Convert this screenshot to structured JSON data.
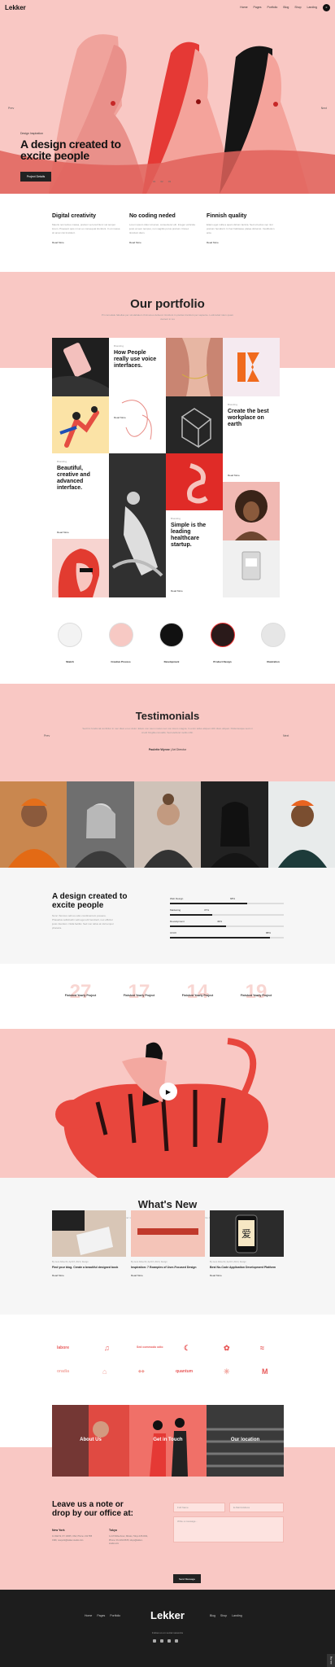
{
  "nav": {
    "logo": "Lekker",
    "links": [
      "Home",
      "Pages",
      "Portfolio",
      "Blog",
      "Shop",
      "Landing"
    ],
    "cart_count": "0"
  },
  "hero": {
    "prev": "Prev",
    "next": "Next",
    "eyebrow": "Design Inspiration",
    "title": "A design created to excite people",
    "button": "Project Details",
    "dots": [
      "01",
      "02",
      "03"
    ]
  },
  "features": [
    {
      "title": "Digital creativity",
      "text": "Mauris non lectus massa, pretium vel erat Nunc vel tempor lorem. Praesent quis mi ac ex consequat tincidunt. In ut massa sit amet nisi tincidunt.",
      "more": "Read More"
    },
    {
      "title": "No coding neded",
      "text": "Lorem ipsum dolor sit amet, consectetur elit. Integer vehicula justo at sem tempus, non sagittis purus pretium. Donec tincidunt diam.",
      "more": "Read More"
    },
    {
      "title": "Finnish quality",
      "text": "Etiam eget nulla a quam dictum lacinia. Sed ut lectus nec nisl pretium hendrerit. In hac habitasse platea dictumst. Vestibulum ante.",
      "more": "Read More"
    }
  ],
  "portfolio": {
    "title": "Our portfolio",
    "subtitle": "Pri consulatu fabellas per sinulabalem thrimuneo debecor tincidunt in pisclas tincidunt per sapiente. Ludimulatr idem quam doctent in ius",
    "tiles": [
      {
        "cat": "Branding",
        "title": "How People really use voice interfaces.",
        "more": "Read More"
      },
      {
        "cat": "Branding",
        "title": "Create the best workplace on earth",
        "more": "Read More"
      },
      {
        "cat": "Branding",
        "title": "Beautiful, creative and advanced interface.",
        "more": "Read More"
      },
      {
        "cat": "Branding",
        "title": "Simple is the leading healthcare startup.",
        "more": "Read More"
      }
    ],
    "categories": [
      "Sketch",
      "Creative Process",
      "Development",
      "Product Design",
      "Illustration"
    ]
  },
  "testimonials": {
    "title": "Testimonials",
    "prev": "Prev",
    "next": "Next",
    "quote": "Sed hic fundis tal conficitur in nec diam et ex dolor. Etiam non tuum metus nec non lorem magna. In enim tellus aliquet nibh diam aliquet. Pellentesque sed mi id elit fringilla convallis. Sed eleifend mollis nibh.",
    "author": "Paulette Wynne",
    "role": "Art Director"
  },
  "skills": {
    "title": "A design created to excite people",
    "text": "Nunc rhoncus velit eu odio condimentum posuere. Phasellus sollicitudin velit eget elit hendrerit, nec efficitur justo interdum. Nulla facilisi. Sed non tellus at nisl tempor pharetra.",
    "bars": [
      {
        "label": "Web Design",
        "pct": "68%",
        "value": 68
      },
      {
        "label": "Marketing",
        "pct": "37%",
        "value": 37
      },
      {
        "label": "Development",
        "pct": "49%",
        "value": 49
      },
      {
        "label": "UI/UX",
        "pct": "88%",
        "value": 88
      }
    ]
  },
  "counts": [
    {
      "num": "27",
      "label": "Finished Yearly Project"
    },
    {
      "num": "17",
      "label": "Finished Yearly Project"
    },
    {
      "num": "14",
      "label": "Finished Yearly Project"
    },
    {
      "num": "19",
      "label": "Finished Yearly Project"
    }
  ],
  "video": {
    "play": "▶"
  },
  "news": {
    "title": "What's New",
    "subtitle": "Pri consulatu fabellas per sinulabalem thrimuneo debecor tincidunt in pisclas tincidunt per sapiente. Ludimulatr idem quam doctent in ius",
    "posts": [
      {
        "meta": "By Gero Albrecht | April 8, 2021 | Design",
        "title": "Find your blog. Create a beautiful designed book",
        "more": "Read More"
      },
      {
        "meta": "By Gero Albrecht | April 8, 2021 | Design",
        "title": "Inspiration: 7 Examples of User-Focused Design",
        "more": "Read More"
      },
      {
        "meta": "By Gero Albrecht | April 8, 2021 | Design",
        "title": "Best No-Code Application Development Platform",
        "more": "Read More"
      }
    ]
  },
  "logos": [
    "labore",
    "♫",
    "Sed commodo odio",
    "☾",
    "✿",
    "≈",
    "oradia",
    "⌂",
    "◆◆",
    "quantum",
    "✳",
    "M"
  ],
  "cta": {
    "tiles": [
      "About Us",
      "Get in Touch",
      "Our location"
    ]
  },
  "contact": {
    "title": "Leave us a note or drop by our office at:",
    "offices": [
      {
        "city": "New York",
        "lines": "11 Wall St, NY 10005, USA, Phone: 212 555 0199, newyork@lekker-studio.com"
      },
      {
        "city": "Tokyo",
        "lines": "4-2-8 Shiba-Koen, Minato, Tokyo 105-0011, Phone: 03-1234-5678, tokyo@lekker-studio.com"
      }
    ],
    "name_ph": "Full Name",
    "email_ph": "E-Mail Address",
    "msg_ph": "Write a message...",
    "send": "Send Message"
  },
  "footer": {
    "logo": "Lekker",
    "left_links": [
      "Home",
      "Pages",
      "Portfolio"
    ],
    "right_links": [
      "Blog",
      "Shop",
      "Landing"
    ],
    "subtitle": "Follow us on social networks",
    "badge": "Buy now"
  },
  "colors": {
    "pink": "#f9c8c4",
    "dark": "#1d1d1d",
    "accent": "#e85a5a"
  }
}
